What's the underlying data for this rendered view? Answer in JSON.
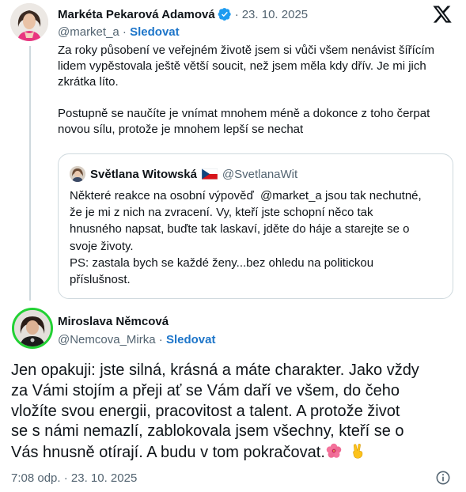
{
  "colors": {
    "text_primary": "#0f1419",
    "text_secondary": "#536471",
    "link_blue": "#1d75c9",
    "verified_blue": "#1d9bf0",
    "border": "#cfd9de",
    "avatar_ring_green": "#22d134"
  },
  "x_logo": {
    "icon": "x-logo-icon"
  },
  "tweet": {
    "author_name": "Markéta Pekarová Adamová",
    "verified_icon": "verified-badge-icon",
    "separator": "·",
    "date": "23. 10. 2025",
    "handle": "@market_a",
    "handle_separator": " · ",
    "follow_label": "Sledovat",
    "paragraph_1": "Za roky působení ve veřejném životě jsem si vůči všem nenávist šířícím lidem vypěstovala ještě větší soucit, než jsem měla kdy dřív. Je mi jich zkrátka líto.",
    "paragraph_2": "Postupně se naučíte je vnímat mnohem méně a dokonce z toho čerpat novou sílu, protože je mnohem lepší se nechat"
  },
  "quote": {
    "author_name": "Světlana Witowská",
    "flag_icon": "czech-flag-icon",
    "handle": "@SvetlanaWit",
    "lines": [
      "Některé reakce na osobní výpověď  @market_a jsou tak nechutné,",
      "že je mi z nich na zvracení. Vy, kteří jste schopní něco tak",
      "hnusného napsat, buďte tak laskaví, jděte do háje a starejte se o",
      "svoje životy.",
      "PS: zastala bych se každé ženy...bez ohledu na politickou",
      "příslušnost."
    ]
  },
  "reply": {
    "author_name": "Miroslava Němcová",
    "handle": "@Nemcova_Mirka",
    "handle_separator": " · ",
    "follow_label": "Sledovat",
    "lines": [
      "Jen opakuji: jste silná, krásná a máte charakter. Jako vždy",
      "za Vámi stojím a přeji ať se Vám daří ve všem, do čeho",
      "vložíte svou energii, pracovitost a talent. A protože život",
      "se s námi nemazlí, zablokovala jsem všechny, kteří se o",
      "Vás hnusně otírají. A budu v tom pokračovat."
    ],
    "emoji_1": "hibiscus-emoji-icon",
    "emoji_2": "victory-hand-emoji-icon",
    "timestamp": "7:08 odp. · 23. 10. 2025",
    "info_icon": "info-icon"
  }
}
